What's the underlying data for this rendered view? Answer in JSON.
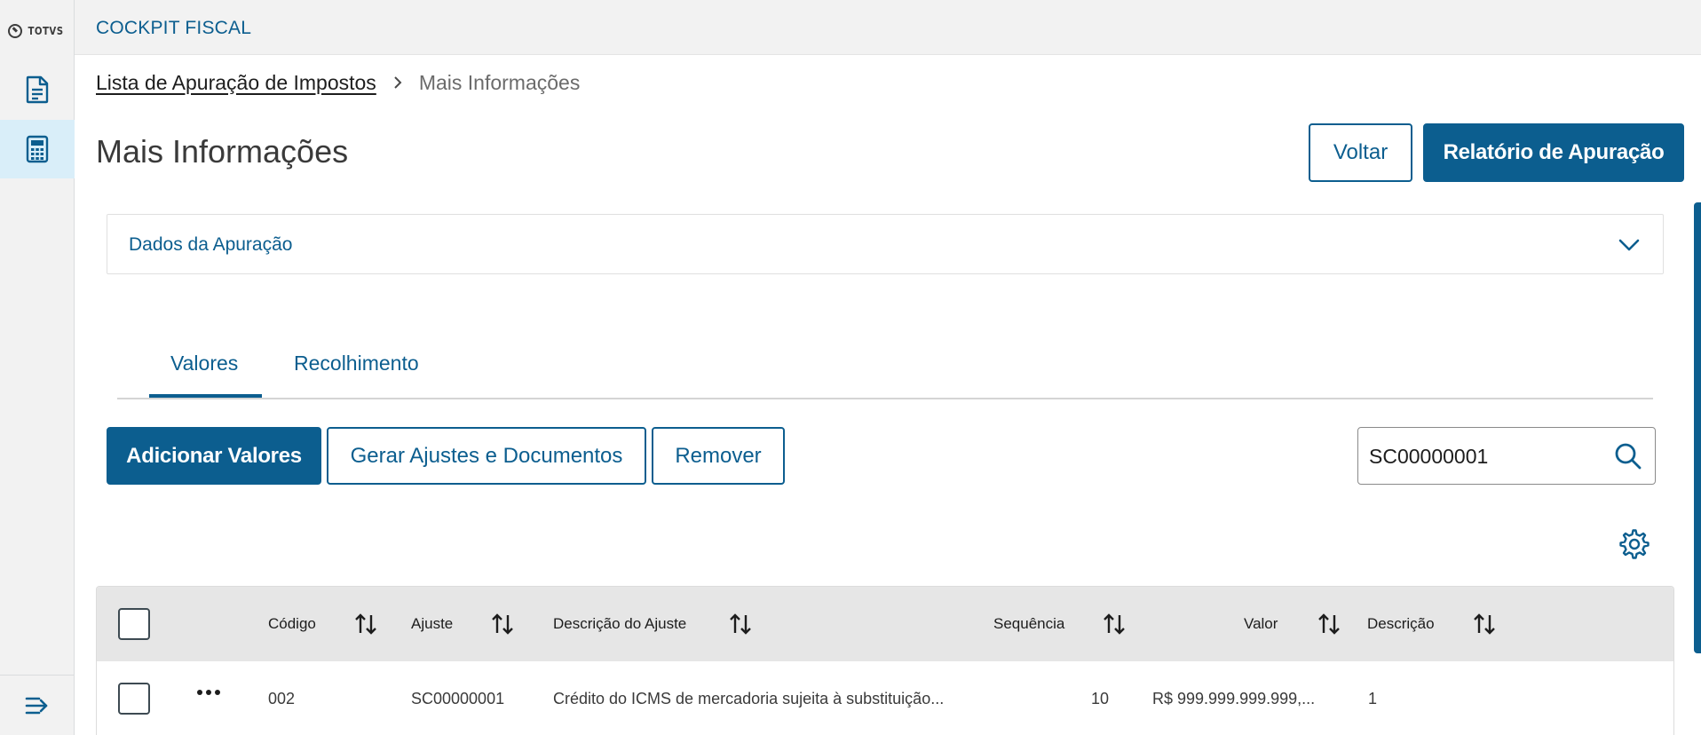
{
  "sidebar": {
    "logo_text": "TOTVS",
    "items": [
      {
        "icon": "document-icon",
        "active": false
      },
      {
        "icon": "calculator-icon",
        "active": true
      }
    ],
    "collapse_icon": "menu-collapse-icon"
  },
  "header": {
    "app_title": "COCKPIT FISCAL"
  },
  "breadcrumb": {
    "parent": "Lista de Apuração de Impostos",
    "current": "Mais Informações"
  },
  "page": {
    "title": "Mais Informações",
    "back_label": "Voltar",
    "report_label": "Relatório de Apuração"
  },
  "accordion": {
    "label": "Dados da Apuração"
  },
  "tabs": [
    {
      "label": "Valores",
      "active": true
    },
    {
      "label": "Recolhimento",
      "active": false
    }
  ],
  "actions": {
    "add_label": "Adicionar Valores",
    "generate_label": "Gerar Ajustes e Documentos",
    "remove_label": "Remover"
  },
  "search": {
    "value": "SC00000001"
  },
  "table": {
    "columns": [
      "Código",
      "Ajuste",
      "Descrição do Ajuste",
      "Sequência",
      "Valor",
      "Descrição"
    ],
    "rows": [
      {
        "codigo": "002",
        "ajuste": "SC00000001",
        "descricao_ajuste": "Crédito do ICMS de mercadoria sujeita à substituição...",
        "sequencia": "10",
        "valor": "R$ 999.999.999.999,...",
        "descricao": "1"
      }
    ]
  },
  "colors": {
    "primary": "#0c5e8f",
    "sidebar_bg": "#f2f2f2",
    "active_item_bg": "#d9eef9",
    "table_header_bg": "#e6e6e6"
  }
}
